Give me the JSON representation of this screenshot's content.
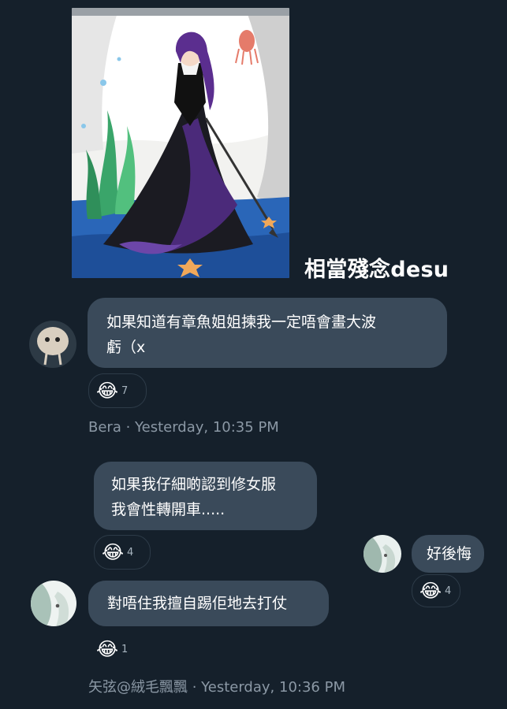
{
  "shared_image": {
    "caption": "相當殘念desu"
  },
  "messages": [
    {
      "sender": "Bera",
      "text_lines": [
        "如果知道有章魚姐姐揀我一定唔會畫大波",
        "虧（x"
      ],
      "reaction": {
        "emoji": "😂",
        "count": "7"
      },
      "meta": "Bera · Yesterday, 10:35 PM"
    },
    {
      "text_lines": [
        "如果我仔細啲認到修女服",
        "我會性轉開車....."
      ],
      "reaction": {
        "emoji": "😂",
        "count": "4"
      }
    },
    {
      "text_lines": [
        "好後悔"
      ],
      "reaction": {
        "emoji": "😂",
        "count": "4"
      }
    },
    {
      "sender": "矢弦@絨毛飄飄",
      "text_lines": [
        "對唔住我擅自踢佢地去打仗"
      ],
      "reaction": {
        "emoji": "😂",
        "count": "1"
      },
      "meta": "矢弦@絨毛飄飄 · Yesterday, 10:36 PM"
    }
  ],
  "colors": {
    "background": "#15202b",
    "bubble": "#3a4a5a",
    "meta_text": "#8b98a5"
  }
}
